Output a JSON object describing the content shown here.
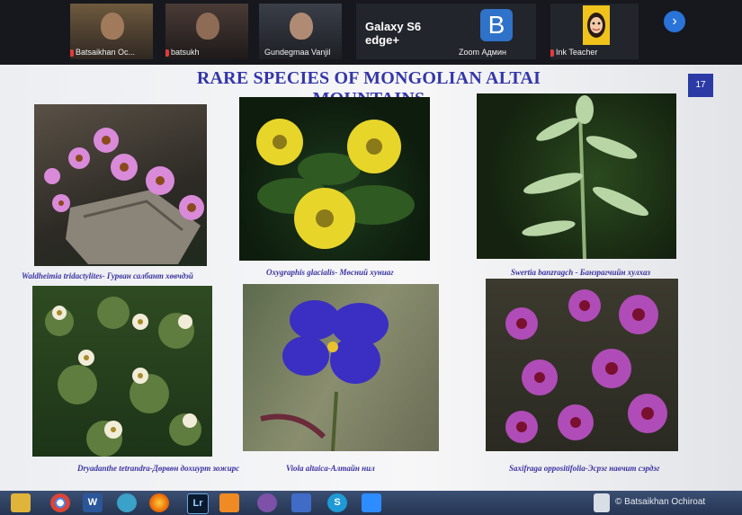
{
  "participants": [
    {
      "name": "Batsaikhan Oc...",
      "muted": true
    },
    {
      "name": "batsukh",
      "muted": true
    },
    {
      "name": "Gundegmaa Vanjil",
      "muted": false
    },
    {
      "name": "Galaxy S6 edge+",
      "muted": false
    },
    {
      "name": "Zoom Админ",
      "initial": "B",
      "muted": false
    },
    {
      "name": "Ink Teacher",
      "muted": true
    }
  ],
  "slide": {
    "title": "RARE SPECIES OF MONGOLIAN ALTAI MOUNTAINS",
    "page_number": "17",
    "captions": [
      "Waldheimia tridactylites- Гурван салбант хөвчдэй",
      "Oxygraphis glacialis- Мөсний хуниаг",
      "Swertia banzragch - Банзрагчийн хулхаз",
      "Dryadanthe tetrandra-Дөрвөн дохиурт зожирс",
      "Viola altaica-Алтайн нил",
      "Saxifraga oppositifolia-Эсрэг навчит сэрдэг"
    ]
  },
  "taskbar": {
    "apps": [
      "file-explorer-icon",
      "chrome-icon",
      "word-icon",
      "app-icon",
      "firefox-icon",
      "lightroom-icon",
      "media-player-icon",
      "viber-icon",
      "paint-icon",
      "skype-icon",
      "zoom-icon"
    ],
    "app_labels": {
      "word": "W",
      "lightroom": "Lr",
      "skype": "S"
    },
    "tray_text": "© Batsaikhan Ochiroat"
  },
  "colors": {
    "slide_title": "#3436a8",
    "caption": "#3a33a0",
    "page_badge": "#2c3aa6",
    "taskbar": "#2b3b5c"
  }
}
